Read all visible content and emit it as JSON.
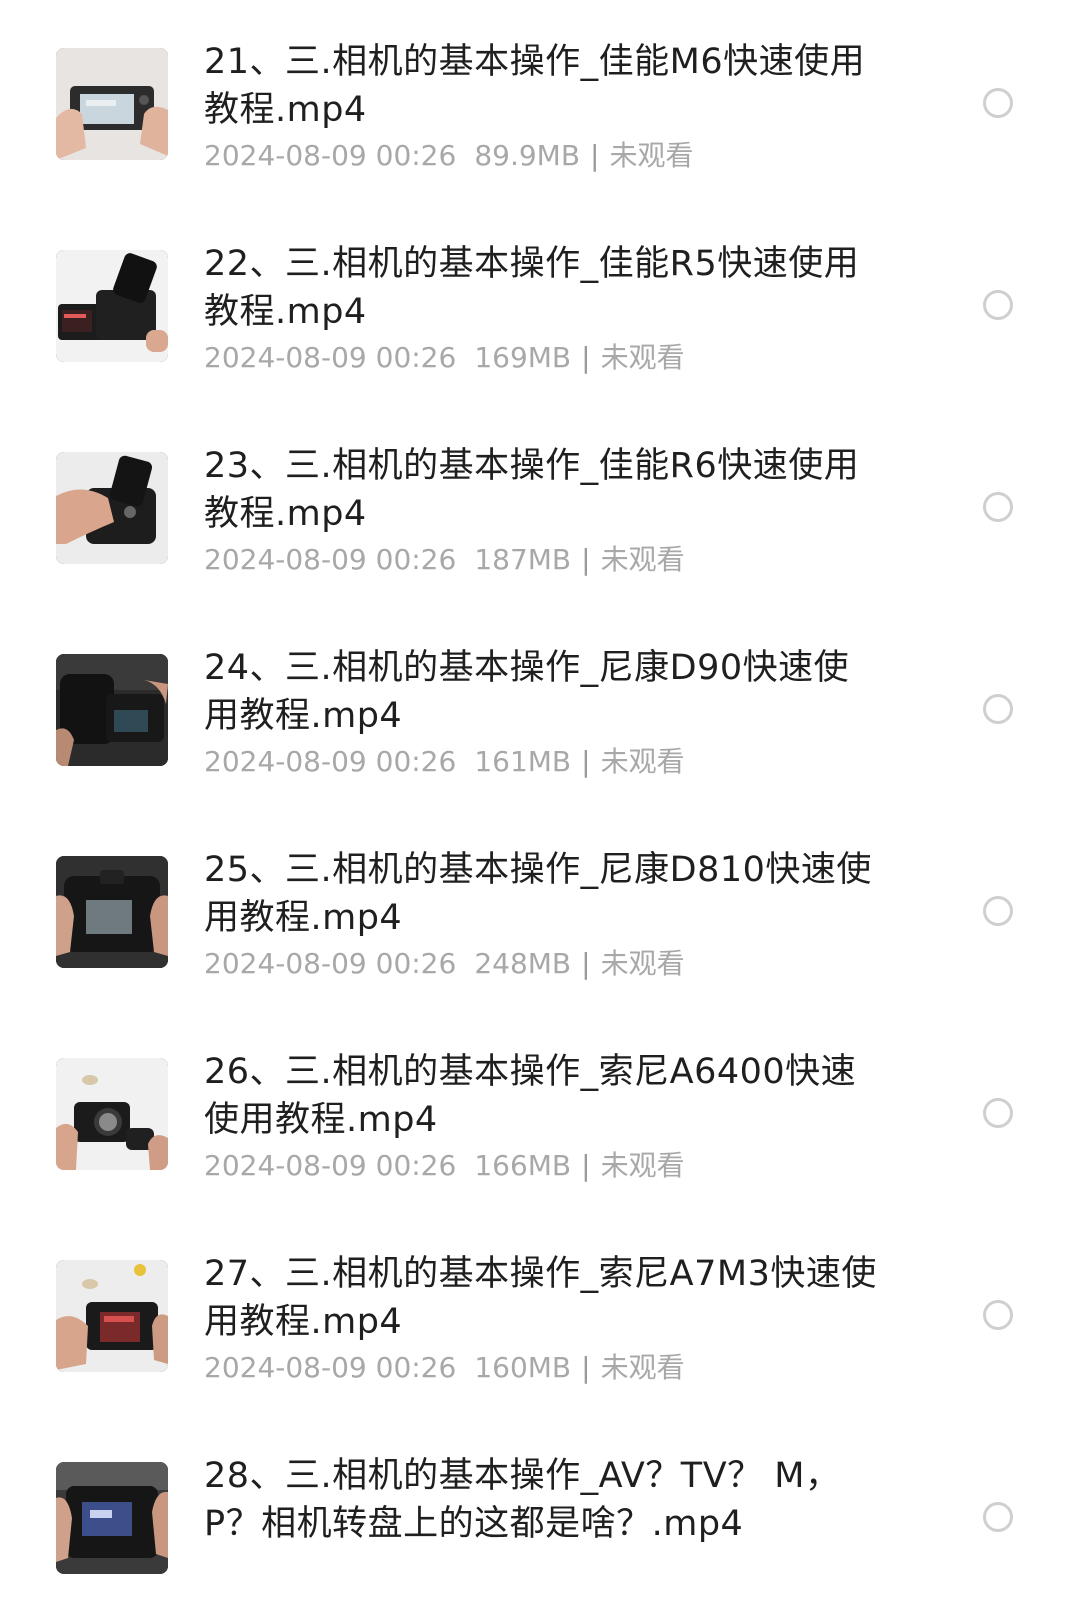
{
  "files": [
    {
      "title": "21、三.相机的基本操作_佳能M6快速使用教程.mp4",
      "date": "2024-08-09 00:26",
      "size": "89.9MB",
      "status": "未观看",
      "thumb": "hands-compact-camera-icon"
    },
    {
      "title": "22、三.相机的基本操作_佳能R5快速使用教程.mp4",
      "date": "2024-08-09 00:26",
      "size": "169MB",
      "status": "未观看",
      "thumb": "camera-lens-up-icon"
    },
    {
      "title": "23、三.相机的基本操作_佳能R6快速使用教程.mp4",
      "date": "2024-08-09 00:26",
      "size": "187MB",
      "status": "未观看",
      "thumb": "hand-on-camera-icon"
    },
    {
      "title": "24、三.相机的基本操作_尼康D90快速使用教程.mp4",
      "date": "2024-08-09 00:26",
      "size": "161MB",
      "status": "未观看",
      "thumb": "dslr-side-icon"
    },
    {
      "title": "25、三.相机的基本操作_尼康D810快速使用教程.mp4",
      "date": "2024-08-09 00:26",
      "size": "248MB",
      "status": "未观看",
      "thumb": "dslr-back-icon"
    },
    {
      "title": "26、三.相机的基本操作_索尼A6400快速使用教程.mp4",
      "date": "2024-08-09 00:26",
      "size": "166MB",
      "status": "未观看",
      "thumb": "mirrorless-lens-off-icon"
    },
    {
      "title": "27、三.相机的基本操作_索尼A7M3快速使用教程.mp4",
      "date": "2024-08-09 00:26",
      "size": "160MB",
      "status": "未观看",
      "thumb": "mirrorless-screen-icon"
    },
    {
      "title": "28、三.相机的基本操作_AV？TV？ M，P？相机转盘上的这都是啥？.mp4",
      "date": "",
      "size": "",
      "status": "",
      "thumb": "camera-back-screen-icon"
    }
  ],
  "colors": {
    "title": "#1f1f1f",
    "meta": "#a8a8a8",
    "radio_border": "#cfcfcf",
    "background": "#ffffff"
  }
}
